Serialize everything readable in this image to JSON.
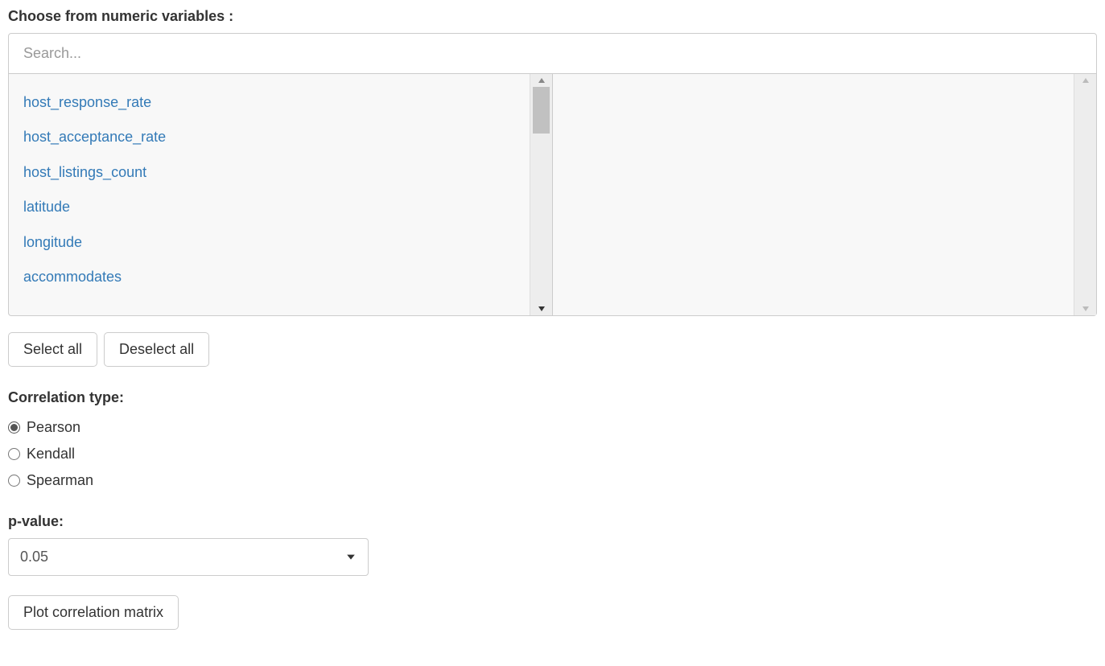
{
  "variables": {
    "label": "Choose from numeric variables :",
    "searchPlaceholder": "Search...",
    "available": [
      "host_response_rate",
      "host_acceptance_rate",
      "host_listings_count",
      "latitude",
      "longitude",
      "accommodates"
    ],
    "selected": []
  },
  "buttons": {
    "selectAll": "Select all",
    "deselectAll": "Deselect all",
    "plot": "Plot correlation matrix"
  },
  "correlation": {
    "label": "Correlation type:",
    "options": [
      "Pearson",
      "Kendall",
      "Spearman"
    ],
    "selected": "Pearson"
  },
  "pvalue": {
    "label": "p-value:",
    "value": "0.05"
  }
}
